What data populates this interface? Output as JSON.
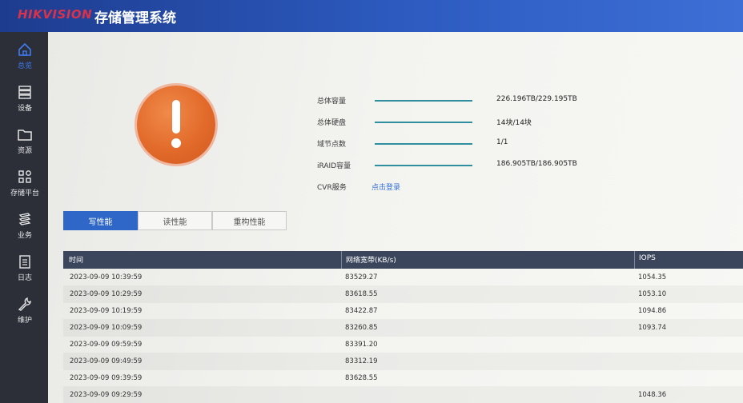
{
  "header": {
    "logo": "HIKVISION",
    "title": "存储管理系统"
  },
  "sidebar": {
    "items": [
      {
        "label": "总览",
        "icon": "home-icon",
        "active": true
      },
      {
        "label": "设备",
        "icon": "server-icon",
        "active": false
      },
      {
        "label": "资源",
        "icon": "folder-icon",
        "active": false
      },
      {
        "label": "存储平台",
        "icon": "grid-icon",
        "active": false
      },
      {
        "label": "业务",
        "icon": "layers-icon",
        "active": false
      },
      {
        "label": "日志",
        "icon": "clipboard-icon",
        "active": false
      },
      {
        "label": "维护",
        "icon": "wrench-icon",
        "active": false
      }
    ]
  },
  "overview": {
    "status_icon": "warning-icon",
    "status_color": "#e26a2a",
    "stats": [
      {
        "label": "总体容量",
        "value": "226.196TB/229.195TB"
      },
      {
        "label": "总体硬盘",
        "value": "14块/14块"
      },
      {
        "label": "域节点数",
        "value": "1/1"
      },
      {
        "label": "iRAID容量",
        "value": "186.905TB/186.905TB"
      }
    ],
    "cvr": {
      "label": "CVR服务",
      "link": "点击登录"
    }
  },
  "tabs": [
    {
      "label": "写性能",
      "active": true
    },
    {
      "label": "读性能",
      "active": false
    },
    {
      "label": "重构性能",
      "active": false
    }
  ],
  "table": {
    "columns": [
      "时间",
      "网络宽带(KB/s)",
      "IOPS"
    ],
    "rows": [
      {
        "time": "2023-09-09 10:39:59",
        "bandwidth": "83529.27",
        "iops": "1054.35"
      },
      {
        "time": "2023-09-09 10:29:59",
        "bandwidth": "83618.55",
        "iops": "1053.10"
      },
      {
        "time": "2023-09-09 10:19:59",
        "bandwidth": "83422.87",
        "iops": "1094.86"
      },
      {
        "time": "2023-09-09 10:09:59",
        "bandwidth": "83260.85",
        "iops": "1093.74"
      },
      {
        "time": "2023-09-09 09:59:59",
        "bandwidth": "83391.20",
        "iops": ""
      },
      {
        "time": "2023-09-09 09:49:59",
        "bandwidth": "83312.19",
        "iops": ""
      },
      {
        "time": "2023-09-09 09:39:59",
        "bandwidth": "83628.55",
        "iops": ""
      },
      {
        "time": "2023-09-09 09:29:59",
        "bandwidth": "",
        "iops": "1048.36"
      }
    ]
  }
}
